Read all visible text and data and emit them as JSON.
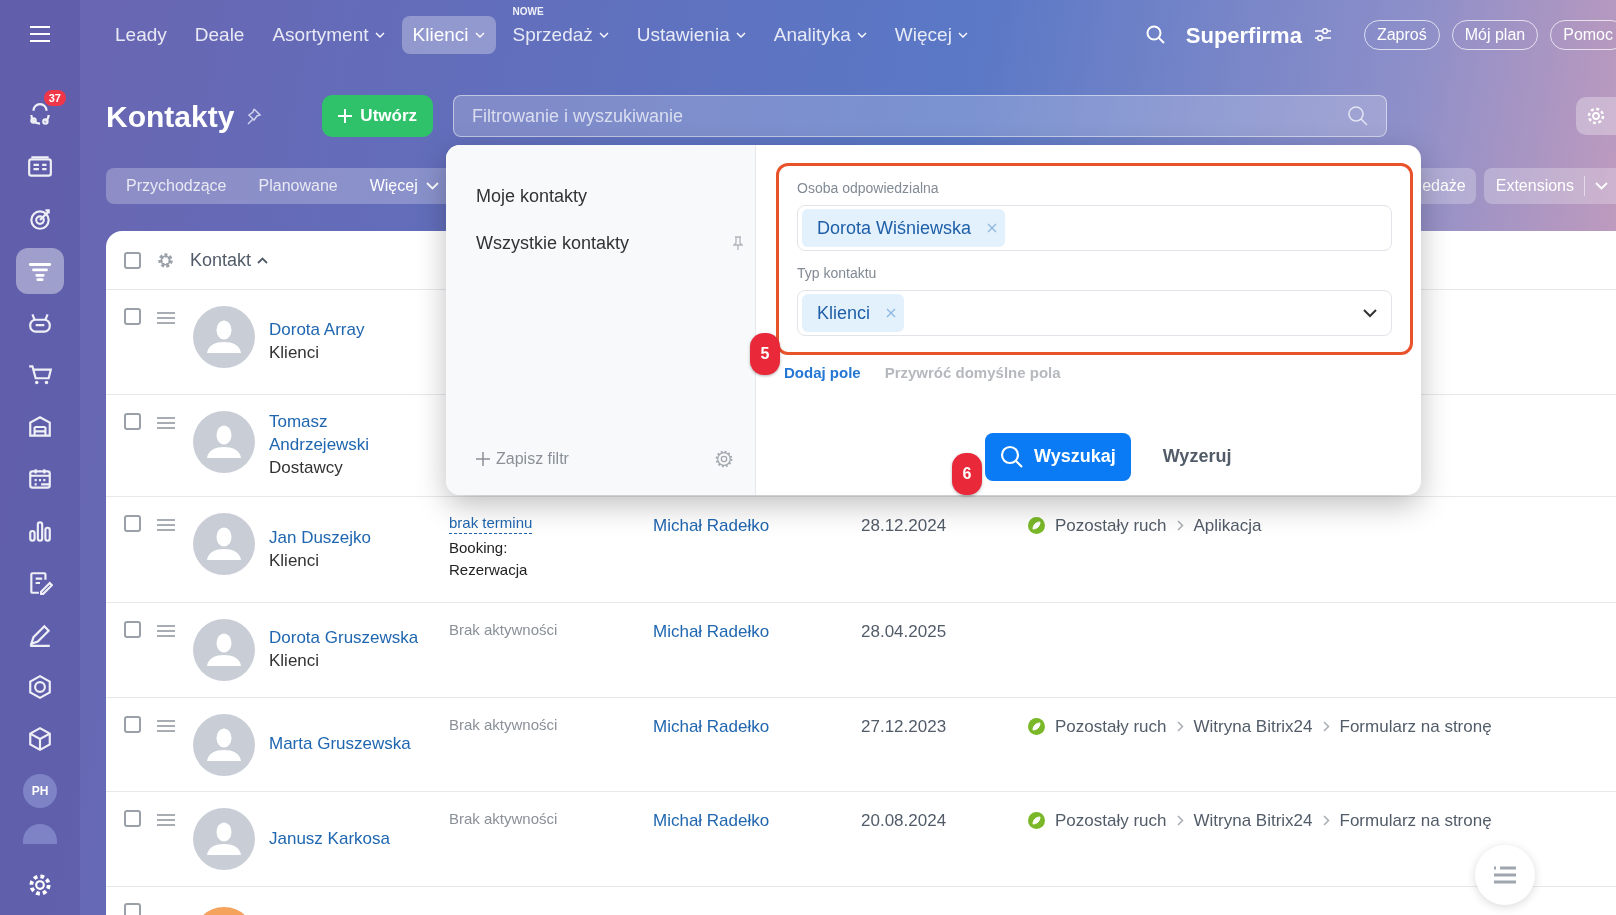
{
  "top_nav": {
    "items": [
      {
        "label": "Leady",
        "selected": false,
        "dropdown": false
      },
      {
        "label": "Deale",
        "selected": false,
        "dropdown": false
      },
      {
        "label": "Asortyment",
        "selected": false,
        "dropdown": true
      },
      {
        "label": "Klienci",
        "selected": true,
        "dropdown": true
      },
      {
        "label": "Sprzedaż",
        "selected": false,
        "dropdown": true,
        "badge": "NOWE"
      },
      {
        "label": "Ustawienia",
        "selected": false,
        "dropdown": true
      },
      {
        "label": "Analityka",
        "selected": false,
        "dropdown": true
      },
      {
        "label": "Więcej",
        "selected": false,
        "dropdown": true
      }
    ],
    "brand": "Superfirma",
    "buttons": [
      "Zaproś",
      "Mój plan",
      "Pomoc"
    ]
  },
  "sidebar": {
    "items": [
      {
        "kind": "icon",
        "selected": false,
        "badge": "37"
      },
      {
        "kind": "icon",
        "selected": false
      },
      {
        "kind": "icon",
        "selected": false
      },
      {
        "kind": "icon",
        "selected": true
      },
      {
        "kind": "icon",
        "selected": false
      },
      {
        "kind": "icon",
        "selected": false
      },
      {
        "kind": "icon",
        "selected": false
      },
      {
        "kind": "icon",
        "selected": false
      },
      {
        "kind": "icon",
        "selected": false
      },
      {
        "kind": "icon",
        "selected": false
      },
      {
        "kind": "icon",
        "selected": false
      },
      {
        "kind": "icon",
        "selected": false
      },
      {
        "kind": "icon",
        "selected": false
      },
      {
        "kind": "avatar",
        "initials": "PH"
      }
    ]
  },
  "page_title": "Kontakty",
  "create_button": "Utwórz",
  "search": {
    "placeholder": "Filtrowanie i wyszukiwanie"
  },
  "tabs": [
    {
      "label": "Przychodzące",
      "dropdown": false
    },
    {
      "label": "Planowane",
      "dropdown": false
    },
    {
      "label": "Więcej",
      "dropdown": true
    }
  ],
  "right_tabs": [
    "edaże",
    "Extensions"
  ],
  "table": {
    "header": "Kontakt",
    "select_all_checked": false,
    "cut_row": {
      "checked": false
    },
    "rows": [
      {
        "name": "Dorota Array",
        "type": "Klienci",
        "checked": false
      },
      {
        "name": "Tomasz Andrzejewski",
        "type": "Dostawcy",
        "checked": false
      },
      {
        "name": "Jan Duszejko",
        "type": "Klienci",
        "checked": false,
        "activity": {
          "kind": "deadline",
          "text": "brak terminu",
          "note": "Booking: Rezerwacja"
        },
        "responsible": "Michał Radełko",
        "date": "28.12.2024",
        "source": [
          "Pozostały ruch",
          "Aplikacja"
        ]
      },
      {
        "name": "Dorota Gruszewska",
        "type": "Klienci",
        "checked": false,
        "activity": {
          "kind": "none",
          "text": "Brak aktywności"
        },
        "responsible": "Michał Radełko",
        "date": "28.04.2025"
      },
      {
        "name": "Marta Gruszewska",
        "checked": false,
        "activity": {
          "kind": "none",
          "text": "Brak aktywności"
        },
        "responsible": "Michał Radełko",
        "date": "27.12.2023",
        "source": [
          "Pozostały ruch",
          "Witryna Bitrix24",
          "Formularz na stronę"
        ]
      },
      {
        "name": "Janusz Karkosa",
        "checked": false,
        "activity": {
          "kind": "none",
          "text": "Brak aktywności"
        },
        "responsible": "Michał Radełko",
        "date": "20.08.2024",
        "source": [
          "Pozostały ruch",
          "Witryna Bitrix24",
          "Formularz na stronę"
        ]
      }
    ]
  },
  "filter_popup": {
    "presets": [
      {
        "label": "Moje kontakty",
        "pinned": false
      },
      {
        "label": "Wszystkie kontakty",
        "pinned": true
      }
    ],
    "save_filter": "Zapisz filtr",
    "fields": [
      {
        "kind": "tags",
        "label": "Osoba odpowiedzialna",
        "tags": [
          "Dorota Wiśniewska"
        ]
      },
      {
        "kind": "select",
        "label": "Typ kontaktu",
        "tags": [
          "Klienci"
        ]
      }
    ],
    "add_field": "Dodaj pole",
    "restore_fields": "Przywróć domyślne pola",
    "search_button": "Wyszukaj",
    "reset_button": "Wyzeruj",
    "callouts": [
      "5",
      "6"
    ]
  }
}
